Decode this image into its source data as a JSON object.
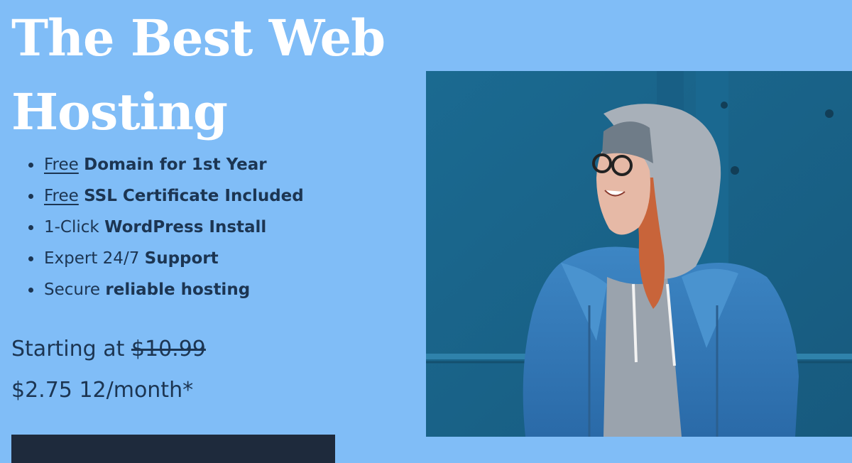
{
  "hero": {
    "title_line1": "The Best Web",
    "title_line2": "Hosting"
  },
  "features": [
    {
      "link": "Free",
      "bold": "Domain for 1st Year"
    },
    {
      "link": "Free",
      "bold": "SSL Certificate Included"
    },
    {
      "prefix": "1-Click",
      "bold": "WordPress Install"
    },
    {
      "prefix": "Expert 24/7",
      "bold": "Support"
    },
    {
      "prefix": "Secure",
      "bold": "reliable hosting"
    }
  ],
  "pricing": {
    "starting_label": "Starting at",
    "old_price": "$10.99",
    "new_price": "$2.75",
    "period": "12/month*"
  },
  "colors": {
    "background": "#80bdf7",
    "headline": "#ffffff",
    "text": "#1c3552",
    "button": "#1e2a3c",
    "photo_wall": "#1f6f95"
  }
}
